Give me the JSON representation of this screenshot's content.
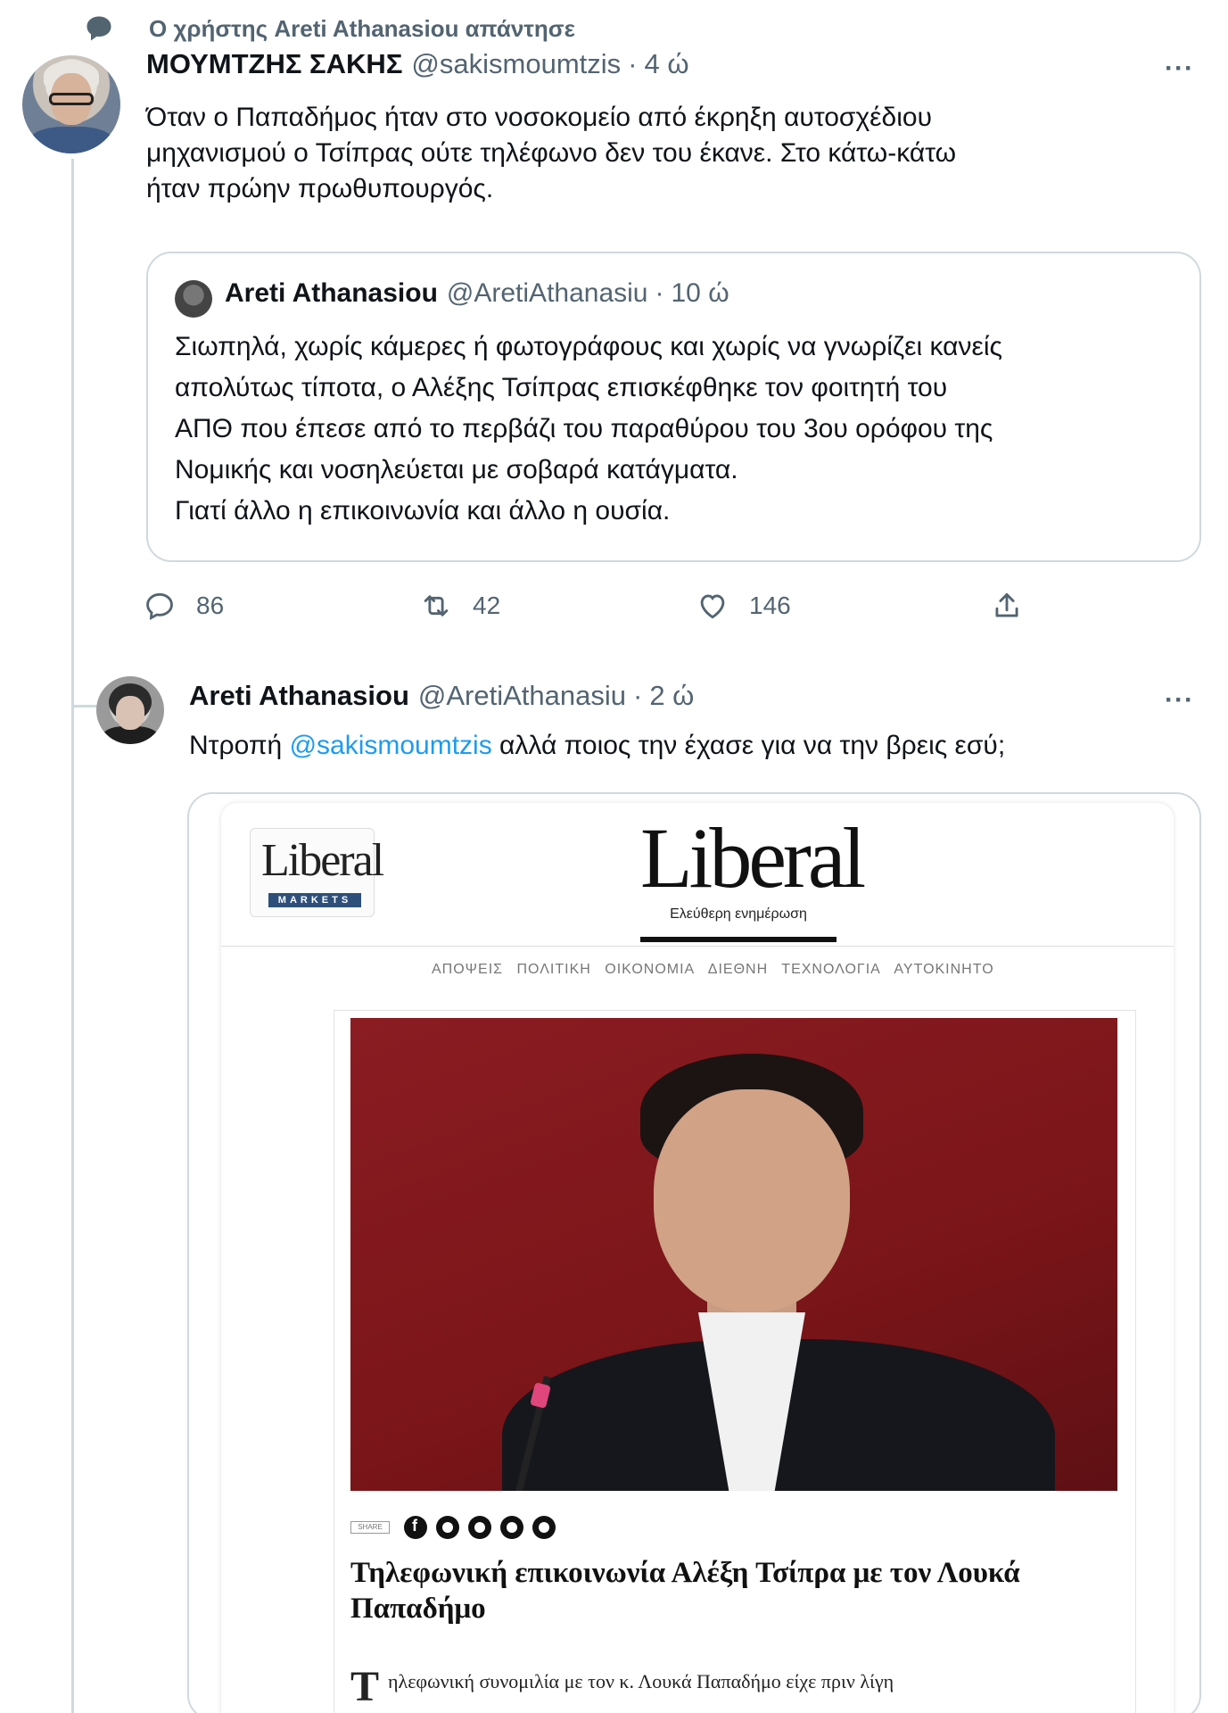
{
  "social_context": {
    "text": "Ο χρήστης Areti Athanasiou απάντησε"
  },
  "tweet1": {
    "name": "ΜΟΥΜΤΖΗΣ ΣΑΚΗΣ",
    "handle": "@sakismoumtzis",
    "separator": "·",
    "time": "4 ώ",
    "text_lines": [
      "Όταν ο Παπαδήμος ήταν στο νοσοκομείο από έκρηξη αυτοσχέδιου",
      "μηχανισμού ο Τσίπρας ούτε τηλέφωνο δεν του έκανε. Στο κάτω-κάτω",
      "ήταν πρώην πρωθυπουργός."
    ],
    "more_label": "···",
    "quote": {
      "name": "Areti Athanasiou",
      "handle": "@AretiAthanasiu",
      "separator": "·",
      "time": "10 ώ",
      "text_lines": [
        "Σιωπηλά, χωρίς κάμερες ή φωτογράφους και χωρίς να γνωρίζει κανείς",
        "απολύτως τίποτα, ο Αλέξης Τσίπρας επισκέφθηκε τον φοιτητή του",
        "ΑΠΘ που έπεσε από το περβάζι του παραθύρου του 3ου ορόφου της",
        "Νομικής και νοσηλεύεται με σοβαρά κατάγματα.",
        "Γιατί άλλο η επικοινωνία και άλλο η ουσία."
      ]
    },
    "actions": {
      "replies": "86",
      "retweets": "42",
      "likes": "146"
    }
  },
  "tweet2": {
    "name": "Areti Athanasiou",
    "handle": "@AretiAthanasiu",
    "separator": "·",
    "time": "2 ώ",
    "text_prefix": "Ντροπή ",
    "mention": "@sakismoumtzis",
    "text_suffix": " αλλά ποιος την έχασε για να την βρεις εσύ;",
    "more_label": "···"
  },
  "screenshot": {
    "markets_logo": "Liberal",
    "markets_label": "MARKETS",
    "main_logo": "Liberal",
    "tagline": "Ελεύθερη ενημέρωση",
    "nav": [
      "ΑΠΟΨΕΙΣ",
      "ΠΟΛΙΤΙΚΗ",
      "ΟΙΚΟΝΟΜΙΑ",
      "ΔΙΕΘΝΗ",
      "ΤΕΧΝΟΛΟΓΙΑ",
      "ΑΥΤΟΚΙΝΗΤΟ"
    ],
    "share_label": "SHARE",
    "headline": "Τηλεφωνική επικοινωνία Αλέξη Τσίπρα με τον Λουκά Παπαδήμο",
    "lead_dropcap": "Τ",
    "lead_text": "ηλεφωνική συνομιλία με τον κ. Λουκά Παπαδήμο είχε πριν λίγη"
  },
  "colors": {
    "accent": "#1d9bf0",
    "secondary_text": "#536471",
    "border": "#cfd9de"
  }
}
